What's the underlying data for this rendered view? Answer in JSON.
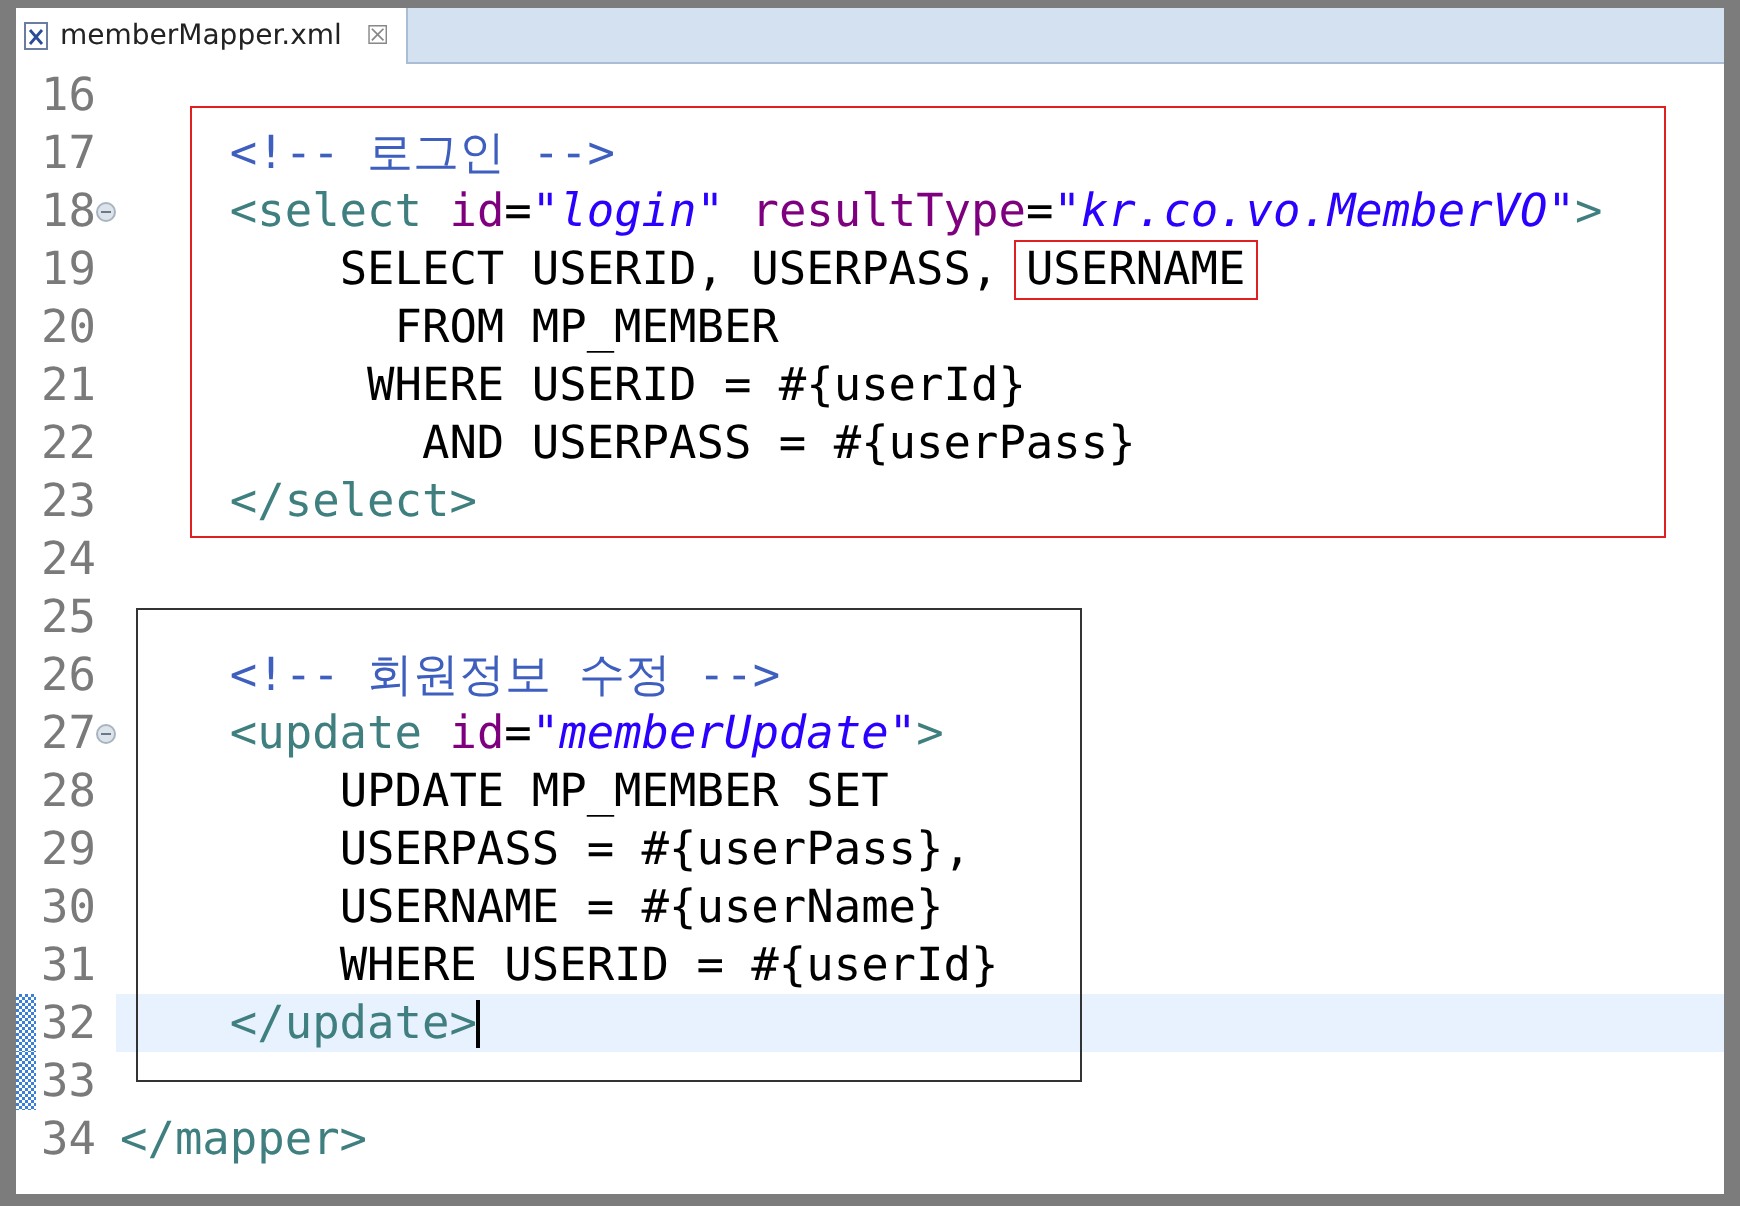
{
  "tab": {
    "title": "memberMapper.xml",
    "close": "☒",
    "selected": true
  },
  "groups": [
    {
      "framed": false,
      "lines": [
        {
          "number": "16",
          "fold": false,
          "current": false,
          "changed": false
        }
      ]
    },
    {
      "framed": true,
      "lines": [
        {
          "number": "17",
          "fold": false,
          "current": false,
          "changed": false,
          "tokens": [
            {
              "kind": "comment",
              "text": "    <!-- 로그인 -->"
            }
          ]
        },
        {
          "number": "18",
          "fold": true,
          "current": false,
          "changed": false,
          "tokens": [
            {
              "kind": "tag",
              "text": "    <select"
            },
            {
              "kind": "attr",
              "text": " id"
            },
            {
              "kind": "text",
              "text": "="
            },
            {
              "kind": "value",
              "text": "\"login\""
            },
            {
              "kind": "attr",
              "text": " resultType"
            },
            {
              "kind": "text",
              "text": "="
            },
            {
              "kind": "value",
              "text": "\"kr.co.vo.MemberVO\""
            },
            {
              "kind": "tag",
              "text": ">"
            }
          ]
        },
        {
          "number": "19",
          "fold": false,
          "current": false,
          "changed": false,
          "tokens": [
            {
              "kind": "text",
              "text": "        SELECT USERID, USERPASS, "
            },
            {
              "kind": "boxed",
              "text": "USERNAME"
            }
          ]
        },
        {
          "number": "20",
          "fold": false,
          "current": false,
          "changed": false,
          "tokens": [
            {
              "kind": "text",
              "text": "          FROM MP_MEMBER"
            }
          ]
        },
        {
          "number": "21",
          "fold": false,
          "current": false,
          "changed": false,
          "tokens": [
            {
              "kind": "text",
              "text": "         WHERE USERID = #{userId}"
            }
          ]
        },
        {
          "number": "22",
          "fold": false,
          "current": false,
          "changed": false,
          "tokens": [
            {
              "kind": "text",
              "text": "           AND USERPASS = #{userPass}"
            }
          ]
        },
        {
          "number": "23",
          "fold": false,
          "current": false,
          "changed": false,
          "tokens": [
            {
              "kind": "tag",
              "text": "    </select>"
            }
          ]
        }
      ]
    },
    {
      "framed": false,
      "lines": [
        {
          "number": "24",
          "fold": false,
          "current": false,
          "changed": false
        }
      ]
    },
    {
      "framed": true,
      "lines": [
        {
          "number": "25",
          "fold": false,
          "current": false,
          "changed": false
        },
        {
          "number": "26",
          "fold": false,
          "current": false,
          "changed": false,
          "tokens": [
            {
              "kind": "comment",
              "text": "    <!-- 회원정보 수정 -->"
            }
          ]
        },
        {
          "number": "27",
          "fold": true,
          "current": false,
          "changed": false,
          "tokens": [
            {
              "kind": "tag",
              "text": "    <update"
            },
            {
              "kind": "attr",
              "text": " id"
            },
            {
              "kind": "text",
              "text": "="
            },
            {
              "kind": "value",
              "text": "\"memberUpdate\""
            },
            {
              "kind": "tag",
              "text": ">"
            }
          ]
        },
        {
          "number": "28",
          "fold": false,
          "current": false,
          "changed": false,
          "tokens": [
            {
              "kind": "text",
              "text": "        UPDATE MP_MEMBER SET"
            }
          ]
        },
        {
          "number": "29",
          "fold": false,
          "current": false,
          "changed": false,
          "tokens": [
            {
              "kind": "text",
              "text": "        USERPASS = #{userPass},"
            }
          ]
        },
        {
          "number": "30",
          "fold": false,
          "current": false,
          "changed": false,
          "tokens": [
            {
              "kind": "text",
              "text": "        USERNAME = #{userName}"
            }
          ]
        },
        {
          "number": "31",
          "fold": false,
          "current": false,
          "changed": false,
          "tokens": [
            {
              "kind": "text",
              "text": "        WHERE USERID = #{userId}"
            }
          ]
        },
        {
          "number": "32",
          "fold": false,
          "current": true,
          "changed": true,
          "tokens": [
            {
              "kind": "tag",
              "text": "    </update>"
            }
          ]
        }
      ]
    },
    {
      "framed": false,
      "lines": [
        {
          "number": "33",
          "fold": false,
          "current": false,
          "changed": true
        },
        {
          "number": "34",
          "fold": false,
          "current": false,
          "changed": false,
          "tokens": [
            {
              "kind": "tag",
              "text": "</mapper>"
            }
          ]
        }
      ]
    }
  ]
}
